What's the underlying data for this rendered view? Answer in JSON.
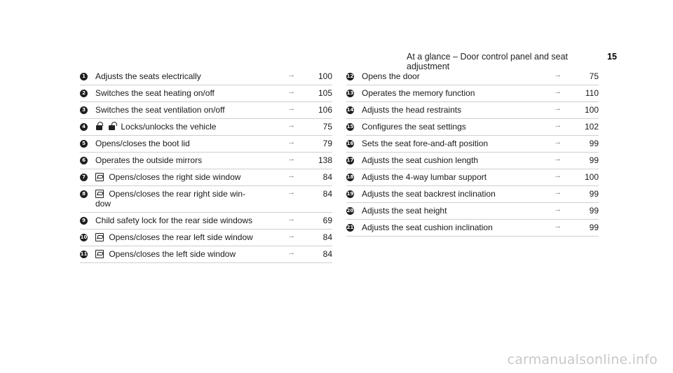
{
  "header": {
    "title": "At a glance – Door control panel and seat adjustment",
    "page_number": "15"
  },
  "left_items": [
    {
      "num": "1",
      "text": "Adjusts the seats electrically",
      "page": "100"
    },
    {
      "num": "2",
      "text": "Switches the seat heating on/off",
      "page": "105"
    },
    {
      "num": "3",
      "text": "Switches the seat ventilation on/off",
      "page": "106"
    },
    {
      "num": "4",
      "text": "Locks/unlocks the vehicle",
      "page": "75"
    },
    {
      "num": "5",
      "text": "Opens/closes the boot lid",
      "page": "79"
    },
    {
      "num": "6",
      "text": "Operates the outside mirrors",
      "page": "138"
    },
    {
      "num": "7",
      "text": "Opens/closes the right side window",
      "page": "84"
    },
    {
      "num": "8",
      "text": "Opens/closes the rear right side win-",
      "text2": "dow",
      "page": "84"
    },
    {
      "num": "9",
      "text": "Child safety lock for the rear side windows",
      "page": "69"
    },
    {
      "num": "10",
      "text": "Opens/closes the rear left side window",
      "page": "84"
    },
    {
      "num": "11",
      "text": "Opens/closes the left side window",
      "page": "84"
    }
  ],
  "right_items": [
    {
      "num": "12",
      "text": "Opens the door",
      "page": "75"
    },
    {
      "num": "13",
      "text": "Operates the memory function",
      "page": "110"
    },
    {
      "num": "14",
      "text": "Adjusts the head restraints",
      "page": "100"
    },
    {
      "num": "15",
      "text": "Configures the seat settings",
      "page": "102"
    },
    {
      "num": "16",
      "text": "Sets the seat fore-and-aft position",
      "page": "99"
    },
    {
      "num": "17",
      "text": "Adjusts the seat cushion length",
      "page": "99"
    },
    {
      "num": "18",
      "text": "Adjusts the 4-way lumbar support",
      "page": "100"
    },
    {
      "num": "19",
      "text": "Adjusts the seat backrest inclination",
      "page": "99"
    },
    {
      "num": "20",
      "text": "Adjusts the seat height",
      "page": "99"
    },
    {
      "num": "21",
      "text": "Adjusts the seat cushion inclination",
      "page": "99"
    }
  ],
  "arrow_glyph": "→",
  "icons": {
    "lock": "lock-icon",
    "unlock": "unlock-icon",
    "window": "window-switch-icon"
  },
  "watermark": "carmanualsonline.info"
}
